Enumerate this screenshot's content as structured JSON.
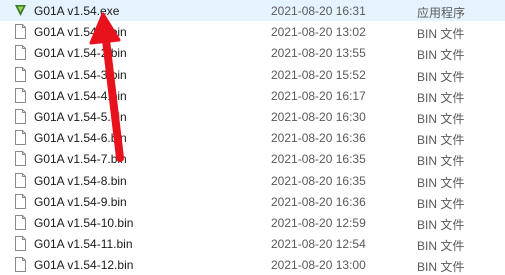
{
  "files": [
    {
      "name": "G01A v1.54.exe",
      "date": "2021-08-20 16:31",
      "type": "应用程序",
      "icon": "app-icon"
    },
    {
      "name": "G01A v1.54-1.bin",
      "date": "2021-08-20 13:02",
      "type": "BIN 文件",
      "icon": "file-icon"
    },
    {
      "name": "G01A v1.54-2.bin",
      "date": "2021-08-20 13:55",
      "type": "BIN 文件",
      "icon": "file-icon"
    },
    {
      "name": "G01A v1.54-3.bin",
      "date": "2021-08-20 15:52",
      "type": "BIN 文件",
      "icon": "file-icon"
    },
    {
      "name": "G01A v1.54-4.bin",
      "date": "2021-08-20 16:17",
      "type": "BIN 文件",
      "icon": "file-icon"
    },
    {
      "name": "G01A v1.54-5.bin",
      "date": "2021-08-20 16:30",
      "type": "BIN 文件",
      "icon": "file-icon"
    },
    {
      "name": "G01A v1.54-6.bin",
      "date": "2021-08-20 16:36",
      "type": "BIN 文件",
      "icon": "file-icon"
    },
    {
      "name": "G01A v1.54-7.bin",
      "date": "2021-08-20 16:35",
      "type": "BIN 文件",
      "icon": "file-icon"
    },
    {
      "name": "G01A v1.54-8.bin",
      "date": "2021-08-20 16:35",
      "type": "BIN 文件",
      "icon": "file-icon"
    },
    {
      "name": "G01A v1.54-9.bin",
      "date": "2021-08-20 16:36",
      "type": "BIN 文件",
      "icon": "file-icon"
    },
    {
      "name": "G01A v1.54-10.bin",
      "date": "2021-08-20 12:59",
      "type": "BIN 文件",
      "icon": "file-icon"
    },
    {
      "name": "G01A v1.54-11.bin",
      "date": "2021-08-20 12:54",
      "type": "BIN 文件",
      "icon": "file-icon"
    },
    {
      "name": "G01A v1.54-12.bin",
      "date": "2021-08-20 13:00",
      "type": "BIN 文件",
      "icon": "file-icon"
    }
  ],
  "annotation": {
    "color": "#e8121c"
  },
  "colors": {
    "selected_row": "#e5f3ff",
    "app_icon": "#3d7a24"
  }
}
